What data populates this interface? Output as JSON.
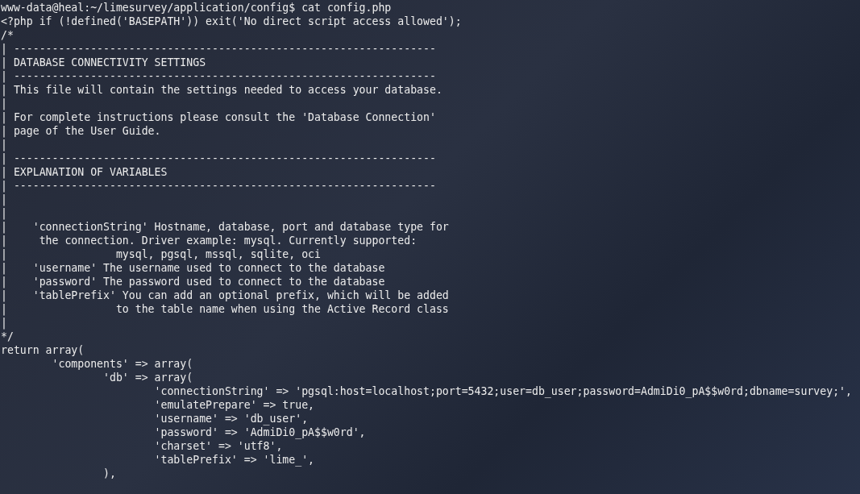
{
  "terminal": {
    "lines": [
      "www-data@heal:~/limesurvey/application/config$ cat config.php",
      "<?php if (!defined('BASEPATH')) exit('No direct script access allowed');",
      "/*",
      "| ------------------------------------------------------------------",
      "| DATABASE CONNECTIVITY SETTINGS",
      "| ------------------------------------------------------------------",
      "| This file will contain the settings needed to access your database.",
      "|",
      "| For complete instructions please consult the 'Database Connection'",
      "| page of the User Guide.",
      "|",
      "| ------------------------------------------------------------------",
      "| EXPLANATION OF VARIABLES",
      "| ------------------------------------------------------------------",
      "|",
      "|",
      "|    'connectionString' Hostname, database, port and database type for",
      "|     the connection. Driver example: mysql. Currently supported:",
      "|                 mysql, pgsql, mssql, sqlite, oci",
      "|    'username' The username used to connect to the database",
      "|    'password' The password used to connect to the database",
      "|    'tablePrefix' You can add an optional prefix, which will be added",
      "|                 to the table name when using the Active Record class",
      "|",
      "*/",
      "return array(",
      "        'components' => array(",
      "                'db' => array(",
      "                        'connectionString' => 'pgsql:host=localhost;port=5432;user=db_user;password=AdmiDi0_pA$$w0rd;dbname=survey;',",
      "                        'emulatePrepare' => true,",
      "                        'username' => 'db_user',",
      "                        'password' => 'AdmiDi0_pA$$w0rd',",
      "                        'charset' => 'utf8',",
      "                        'tablePrefix' => 'lime_',",
      "                ),"
    ]
  }
}
